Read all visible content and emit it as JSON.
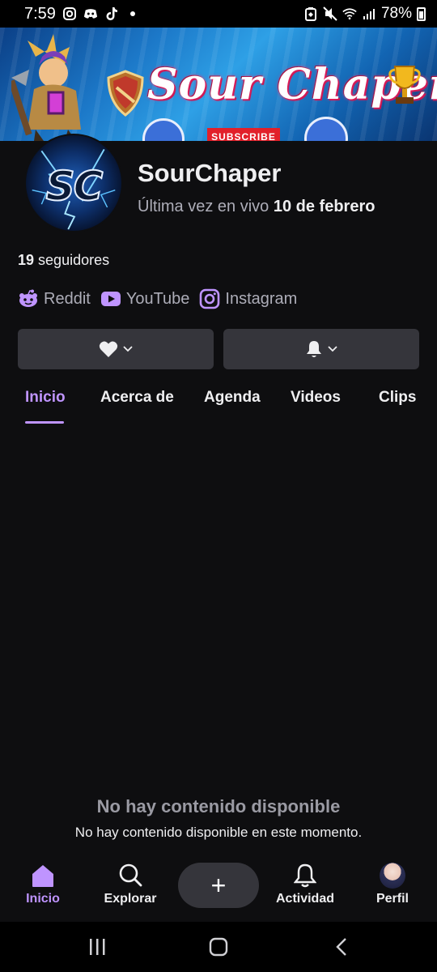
{
  "status_bar": {
    "time": "7:59",
    "battery": "78%",
    "icons": [
      "instagram-icon",
      "discord-icon",
      "tiktok-icon",
      "dot-icon",
      "battery-saver-icon",
      "mute-icon",
      "wifi-icon",
      "signal-icon"
    ]
  },
  "banner": {
    "title": "Sour Chaper",
    "subscribe": "SUBSCRIBE"
  },
  "profile": {
    "avatar_text": "SC",
    "name": "SourChaper",
    "last_live_prefix": "Última vez en vivo",
    "last_live_date": "10 de febrero",
    "followers_count": "19",
    "followers_label": "seguidores"
  },
  "socials": [
    {
      "label": "Reddit",
      "icon": "reddit-icon"
    },
    {
      "label": "YouTube",
      "icon": "youtube-icon"
    },
    {
      "label": "Instagram",
      "icon": "instagram-icon"
    }
  ],
  "tabs": [
    {
      "label": "Inicio",
      "active": true
    },
    {
      "label": "Acerca de"
    },
    {
      "label": "Agenda"
    },
    {
      "label": "Videos"
    },
    {
      "label": "Clips"
    }
  ],
  "empty_state": {
    "title": "No hay contenido disponible",
    "subtitle": "No hay contenido disponible en este momento."
  },
  "bottom_nav": [
    {
      "label": "Inicio",
      "icon": "home-icon",
      "active": true
    },
    {
      "label": "Explorar",
      "icon": "search-icon"
    },
    {
      "label": "+",
      "icon": "plus-icon"
    },
    {
      "label": "Actividad",
      "icon": "bell-icon"
    },
    {
      "label": "Perfil",
      "icon": "avatar"
    }
  ],
  "colors": {
    "accent": "#bf94ff",
    "background": "#0e0e10",
    "button": "#35353b",
    "muted": "#adadb8"
  }
}
